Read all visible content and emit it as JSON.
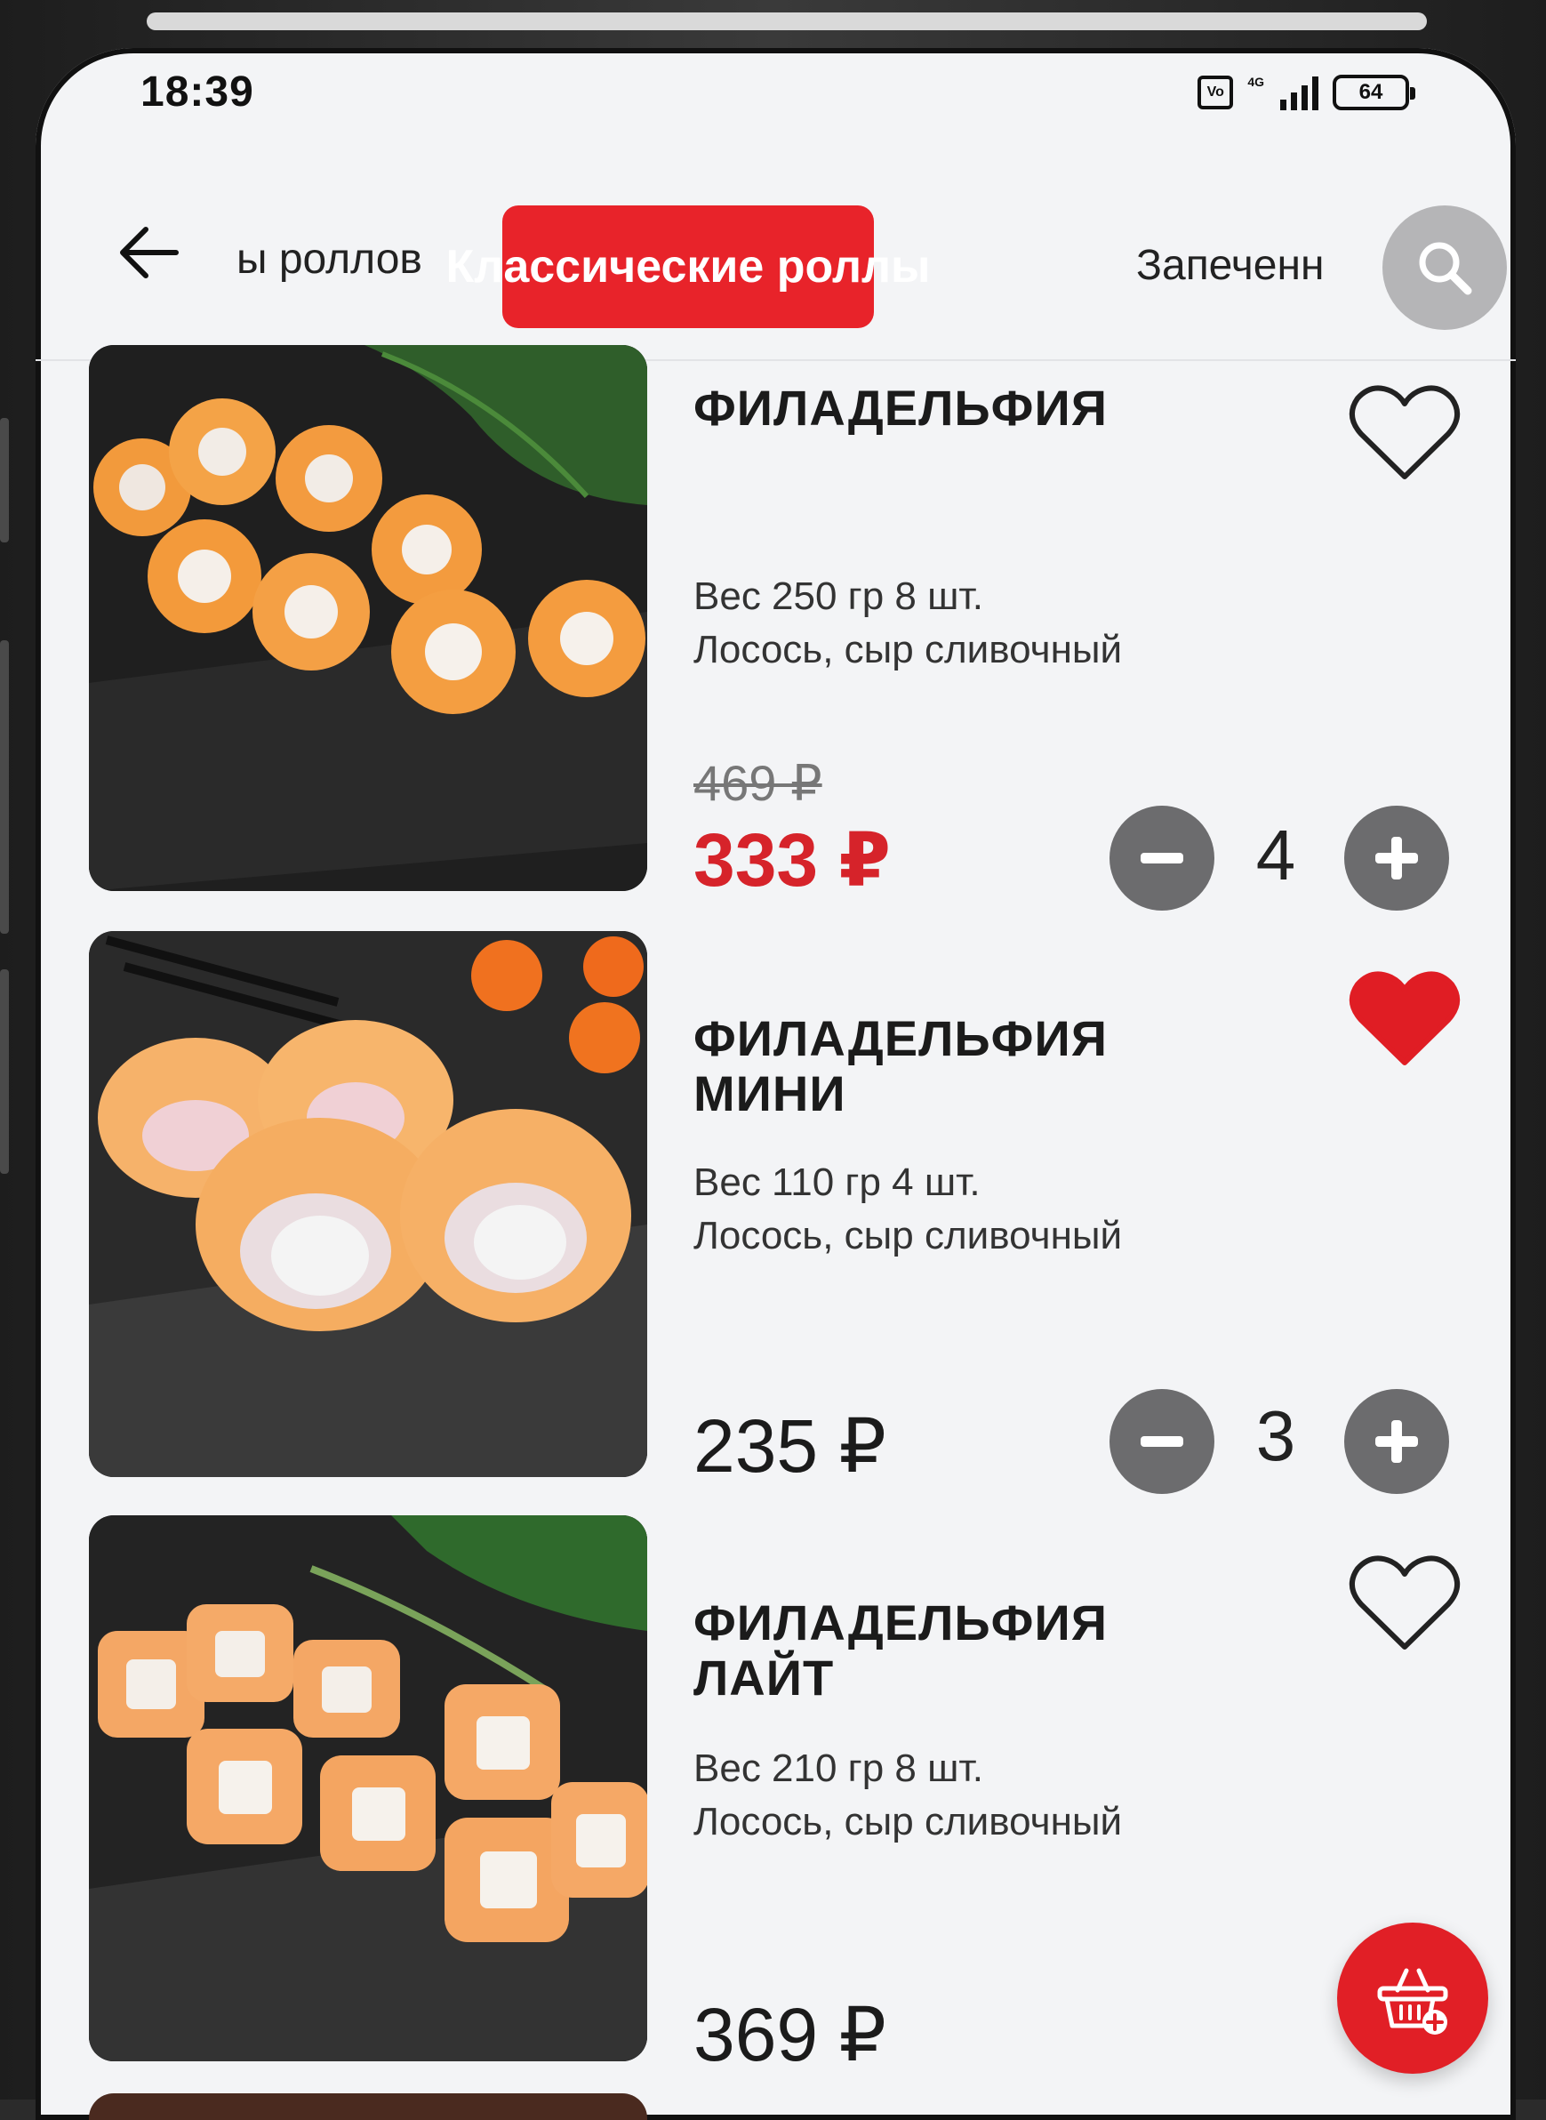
{
  "status_bar": {
    "time": "18:39",
    "battery": "64",
    "network": "4G"
  },
  "nav": {
    "tabs": [
      {
        "label": "ы роллов"
      },
      {
        "label": "Классические роллы"
      },
      {
        "label": "Запеченн"
      }
    ],
    "active_index": 1,
    "accent_color": "#e8232a"
  },
  "products": [
    {
      "title": "ФИЛАДЕЛЬФИЯ",
      "weight": "Вес 250 гр 8 шт.",
      "description": "Лосось, сыр сливочный",
      "old_price": "469 ₽",
      "price": "333 ₽",
      "favorite": false,
      "quantity": "4"
    },
    {
      "title": "ФИЛАДЕЛЬФИЯ МИНИ",
      "weight": "Вес 110 гр 4 шт.",
      "description": "Лосось, сыр сливочный",
      "price": "235 ₽",
      "favorite": true,
      "quantity": "3"
    },
    {
      "title": "ФИЛАДЕЛЬФИЯ ЛАЙТ",
      "weight": "Вес 210 гр 8 шт.",
      "description": "Лосось, сыр сливочный",
      "price": "369 ₽",
      "favorite": false
    }
  ],
  "icons": {
    "back": "back-arrow-icon",
    "search": "search-icon",
    "favorite": "heart-icon",
    "minus": "minus-icon",
    "plus": "plus-icon",
    "cart": "add-to-cart-icon"
  }
}
